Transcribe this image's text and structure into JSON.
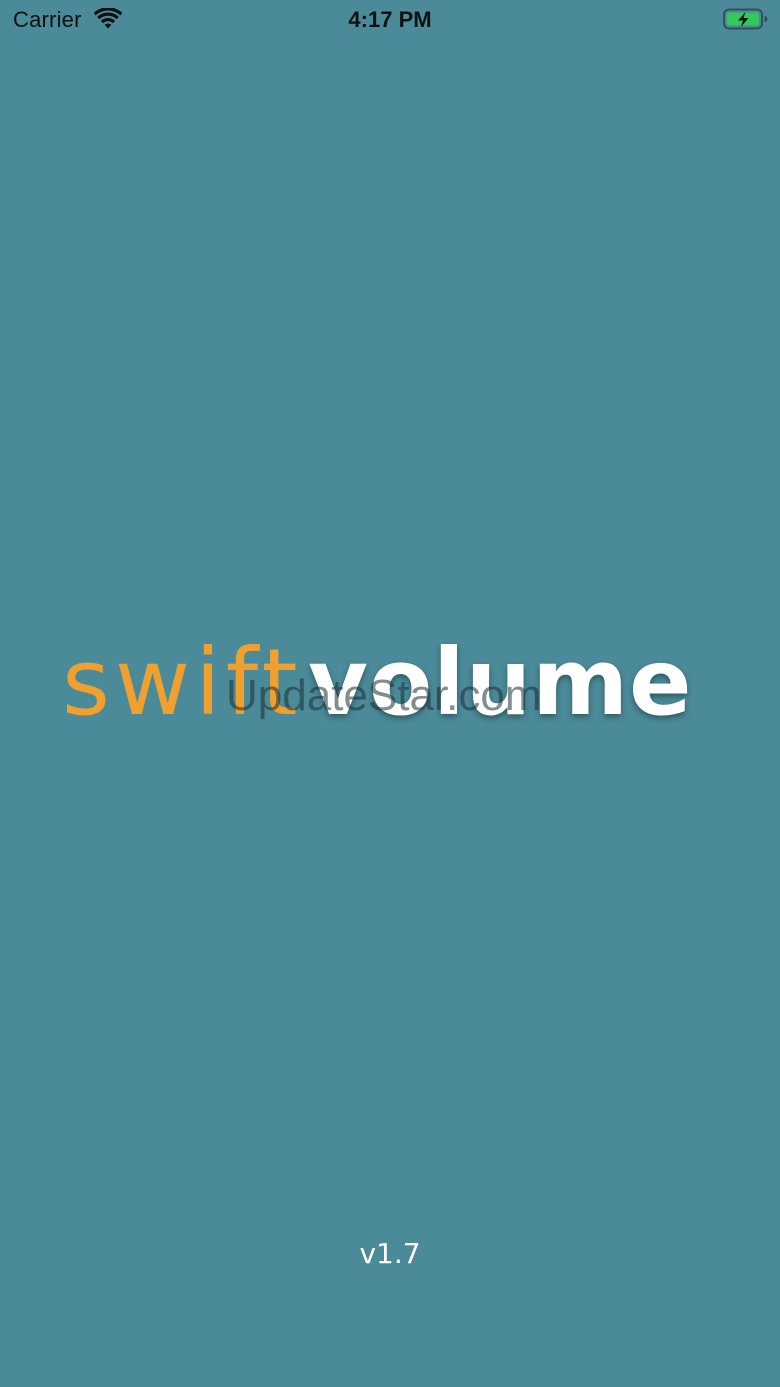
{
  "status_bar": {
    "carrier": "Carrier",
    "time": "4:17 PM",
    "wifi_icon": "wifi-icon",
    "battery_icon": "battery-charging-icon",
    "battery_color": "#34c759"
  },
  "splash": {
    "logo_swift": "swift",
    "logo_volume": "volume",
    "logo_swift_color": "#f0a02e",
    "logo_volume_color": "#ffffff",
    "watermark": "UpdateStar.com",
    "version": "v1.7",
    "background_color": "#4a8a99"
  }
}
